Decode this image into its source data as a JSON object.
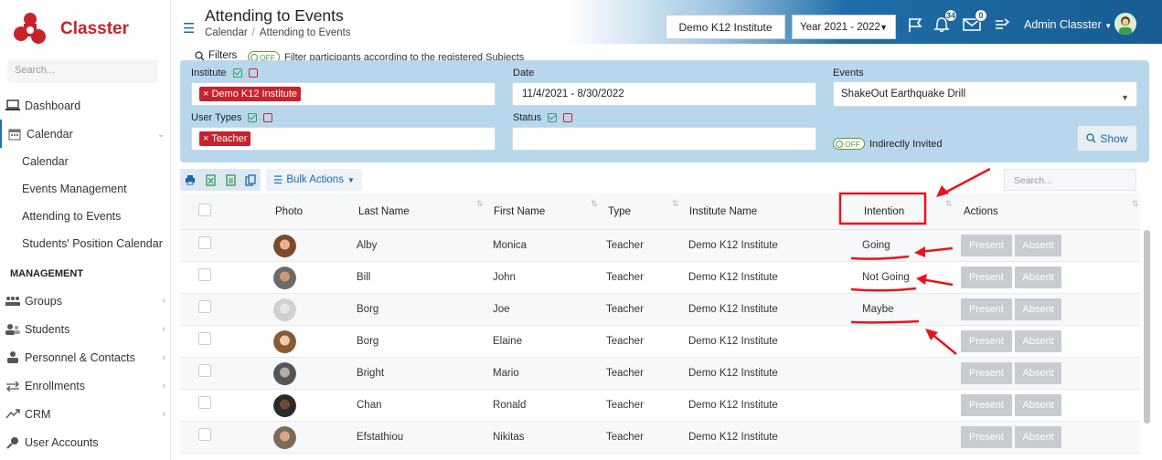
{
  "app": {
    "name": "Classter"
  },
  "sidebar": {
    "search_placeholder": "Search...",
    "items": [
      {
        "label": "Dashboard",
        "icon": "laptop-icon"
      },
      {
        "label": "Calendar",
        "icon": "calendar-icon"
      }
    ],
    "calendar_sub": [
      "Calendar",
      "Events Management",
      "Attending to Events",
      "Students' Position Calendar"
    ],
    "section": "MANAGEMENT",
    "management": [
      {
        "label": "Groups",
        "icon": "groups-icon"
      },
      {
        "label": "Students",
        "icon": "students-icon"
      },
      {
        "label": "Personnel & Contacts",
        "icon": "personnel-icon"
      },
      {
        "label": "Enrollments",
        "icon": "enrollments-icon"
      },
      {
        "label": "CRM",
        "icon": "crm-icon"
      },
      {
        "label": "User Accounts",
        "icon": "key-icon"
      }
    ]
  },
  "header": {
    "title": "Attending to Events",
    "breadcrumb": [
      "Calendar",
      "Attending to Events"
    ],
    "institute": "Demo K12 Institute",
    "year": "Year 2021 - 2022",
    "notifications": "34",
    "messages": "0",
    "user": "Admin Classter"
  },
  "filters": {
    "label": "Filters",
    "toggle_off": "OFF",
    "note": "Filter participants according to the registered Subjects",
    "institute_label": "Institute",
    "institute_chip": "Demo K12 Institute",
    "date_label": "Date",
    "date_value": "11/4/2021 - 8/30/2022",
    "events_label": "Events",
    "events_value": "ShakeOut Earthquake Drill",
    "usertypes_label": "User Types",
    "usertypes_chip": "Teacher",
    "status_label": "Status",
    "indirect_label": "Indirectly Invited",
    "show_label": "Show"
  },
  "toolbar": {
    "bulk_label": "Bulk Actions",
    "search_placeholder": "Search..."
  },
  "table": {
    "headers": {
      "photo": "Photo",
      "last": "Last Name",
      "first": "First Name",
      "type": "Type",
      "inst": "Institute Name",
      "intention": "Intention",
      "actions": "Actions"
    },
    "present_label": "Present",
    "absent_label": "Absent",
    "rows": [
      {
        "last": "Alby",
        "first": "Monica",
        "type": "Teacher",
        "inst": "Demo K12 Institute",
        "intention": "Going"
      },
      {
        "last": "Bill",
        "first": "John",
        "type": "Teacher",
        "inst": "Demo K12 Institute",
        "intention": "Not Going"
      },
      {
        "last": "Borg",
        "first": "Joe",
        "type": "Teacher",
        "inst": "Demo K12 Institute",
        "intention": "Maybe"
      },
      {
        "last": "Borg",
        "first": "Elaine",
        "type": "Teacher",
        "inst": "Demo K12 Institute",
        "intention": ""
      },
      {
        "last": "Bright",
        "first": "Mario",
        "type": "Teacher",
        "inst": "Demo K12 Institute",
        "intention": ""
      },
      {
        "last": "Chan",
        "first": "Ronald",
        "type": "Teacher",
        "inst": "Demo K12 Institute",
        "intention": ""
      },
      {
        "last": "Efstathiou",
        "first": "Nikitas",
        "type": "Teacher",
        "inst": "Demo K12 Institute",
        "intention": ""
      }
    ]
  },
  "colors": {
    "brand": "#c8232c",
    "accent": "#1a6aa8",
    "annotation": "#e8141c"
  }
}
